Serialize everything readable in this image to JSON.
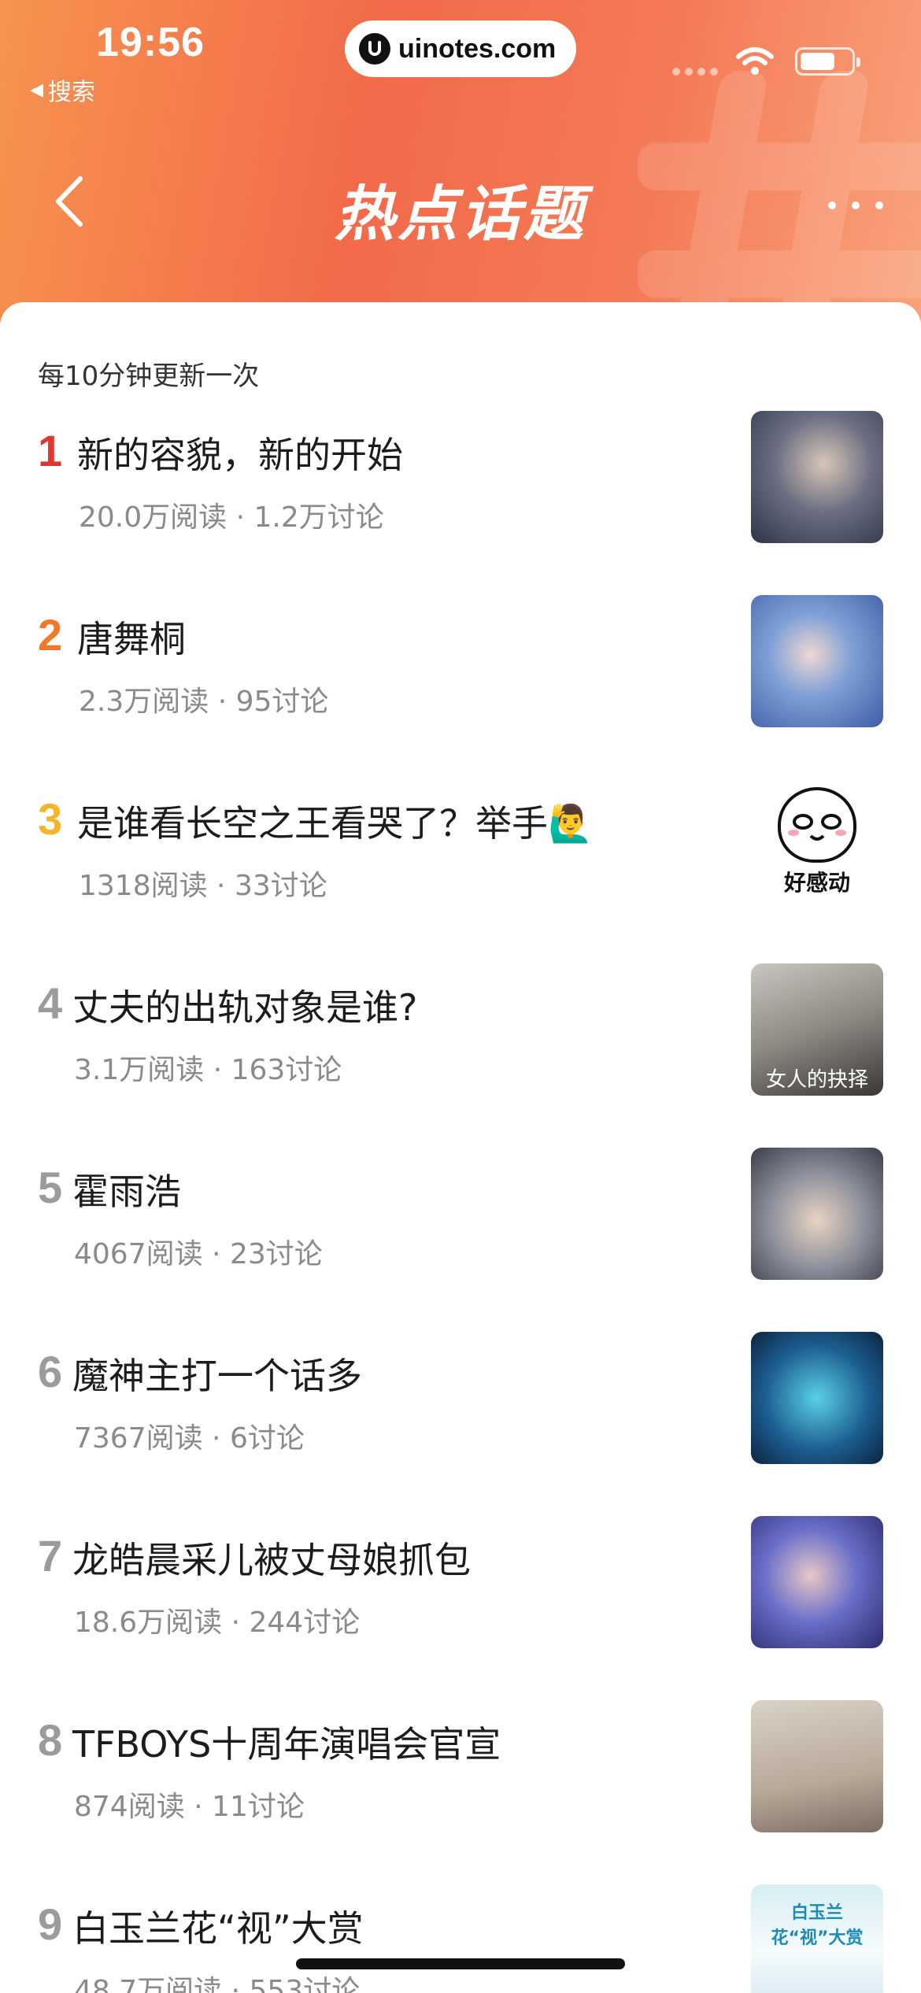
{
  "status_bar": {
    "time": "19:56",
    "back_app": "搜索",
    "url": "uinotes.com"
  },
  "header": {
    "title": "热点话题",
    "gradient_colors": [
      "#f7934f",
      "#f26a4a",
      "#f9a27b"
    ]
  },
  "content": {
    "update_note": "每10分钟更新一次",
    "items": [
      {
        "rank": "1",
        "title": "新的容貌，新的开始",
        "meta": "20.0万阅读 · 1.2万讨论",
        "thumb": "animated-swordsman-image"
      },
      {
        "rank": "2",
        "title": "唐舞桐",
        "meta": "2.3万阅读 · 95讨论",
        "thumb": "animated-blue-hair-girl-image"
      },
      {
        "rank": "3",
        "title": "是谁看长空之王看哭了？举手🙋‍♂️",
        "meta": "1318阅读 · 33讨论",
        "thumb": "crying-meme-sticker",
        "thumb_text": "好感动"
      },
      {
        "rank": "4",
        "title": "丈夫的出轨对象是谁?",
        "meta": "3.1万阅读 · 163讨论",
        "thumb": "drama-still-image",
        "thumb_text": "女人的抉择"
      },
      {
        "rank": "5",
        "title": "霍雨浩",
        "meta": "4067阅读 · 23讨论",
        "thumb": "animated-boy-portrait-image"
      },
      {
        "rank": "6",
        "title": "魔神主打一个话多",
        "meta": "7367阅读 · 6讨论",
        "thumb": "animated-blue-demon-image"
      },
      {
        "rank": "7",
        "title": "龙皓晨采儿被丈母娘抓包",
        "meta": "18.6万阅读 · 244讨论",
        "thumb": "animated-purple-hair-image"
      },
      {
        "rank": "8",
        "title": "TFBOYS十周年演唱会官宣",
        "meta": "874阅读 · 11讨论",
        "thumb": "group-photo-image"
      },
      {
        "rank": "9",
        "title": "白玉兰花“视”大赏",
        "meta": "48.7万阅读 · 553讨论",
        "thumb": "award-poster-image",
        "thumb_text": "白玉兰 花“视”大赏"
      }
    ]
  }
}
